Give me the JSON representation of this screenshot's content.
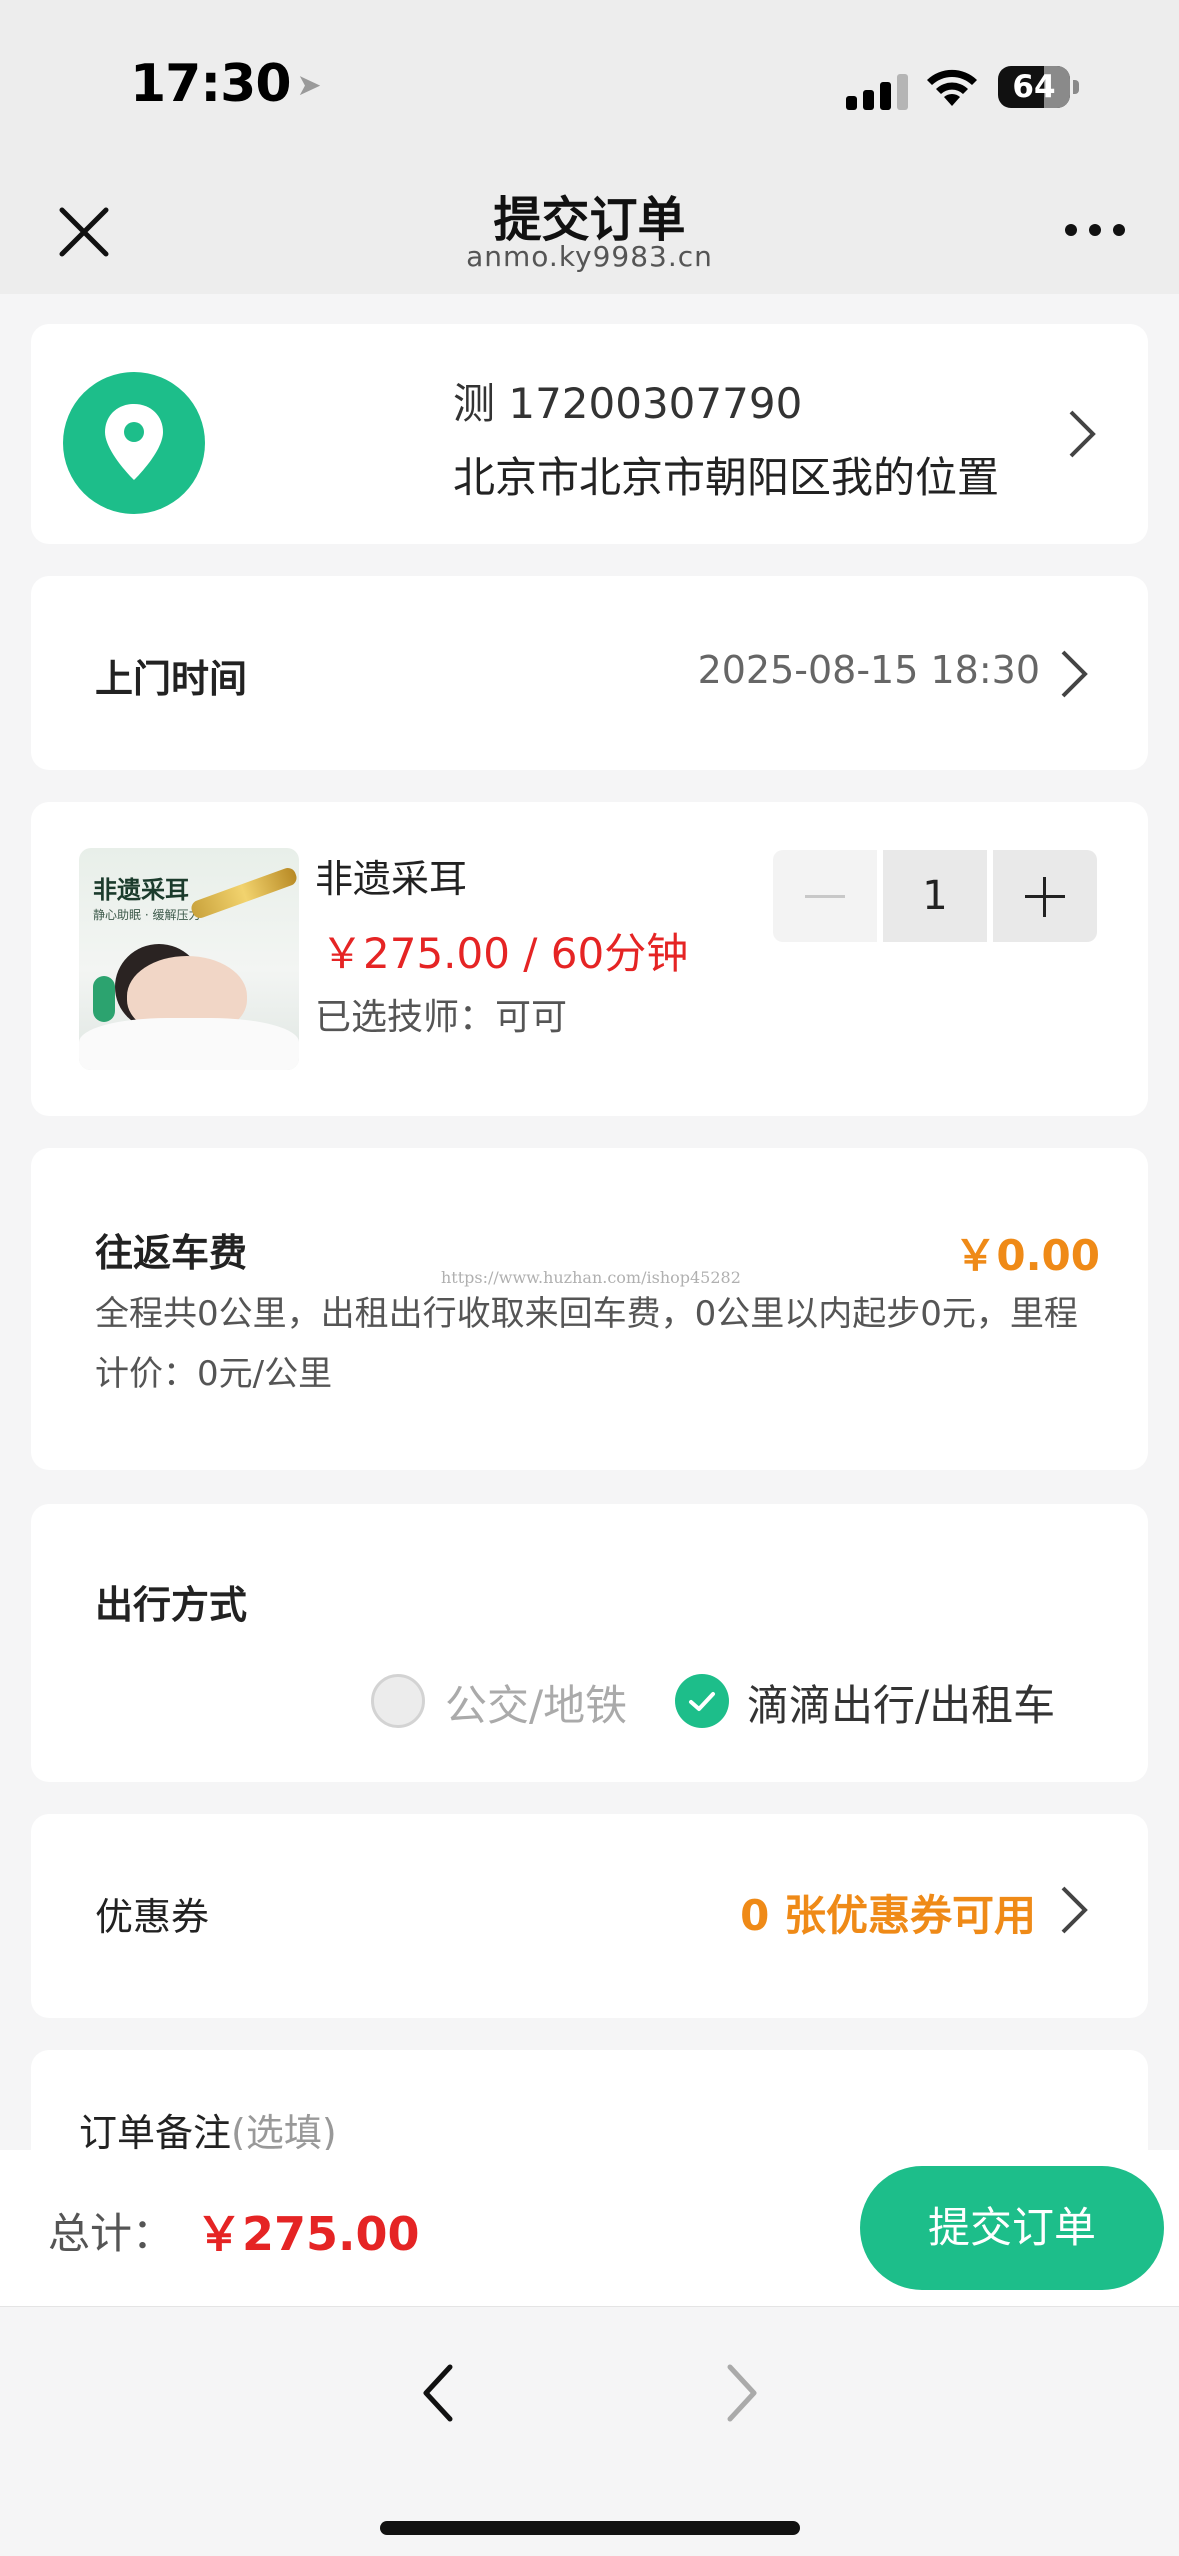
{
  "status": {
    "time": "17:30",
    "battery": "64"
  },
  "nav": {
    "title": "提交订单",
    "subtitle": "anmo.ky9983.cn"
  },
  "address": {
    "contact": "测 17200307790",
    "text": "北京市北京市朝阳区我的位置"
  },
  "visit_time": {
    "label": "上门时间",
    "value": "2025-08-15 18:30"
  },
  "service": {
    "thumb_title": "非遗采耳",
    "thumb_sub": "静心助眠 · 缓解压力",
    "name": "非遗采耳",
    "price": "￥275.00 / 60分钟",
    "technician": "已选技师：可可",
    "quantity": "1"
  },
  "fare": {
    "label": "往返车费",
    "amount": "￥0.00",
    "description": "全程共0公里，出租出行收取来回车费，0公里以内起步0元，里程计价：0元/公里",
    "watermark": "https://www.huzhan.com/ishop45282"
  },
  "travel": {
    "label": "出行方式",
    "options": [
      {
        "label": "公交/地铁",
        "selected": false
      },
      {
        "label": "滴滴出行/出租车",
        "selected": true
      }
    ]
  },
  "coupon": {
    "label": "优惠券",
    "value": "0 张优惠券可用"
  },
  "note": {
    "label": "订单备注",
    "optional": "(选填)"
  },
  "footer": {
    "total_label": "总计：",
    "total_value": "￥275.00",
    "submit_label": "提交订单"
  },
  "colors": {
    "accent": "#1dbe8a",
    "price": "#e52424",
    "highlight": "#ef8a17"
  }
}
